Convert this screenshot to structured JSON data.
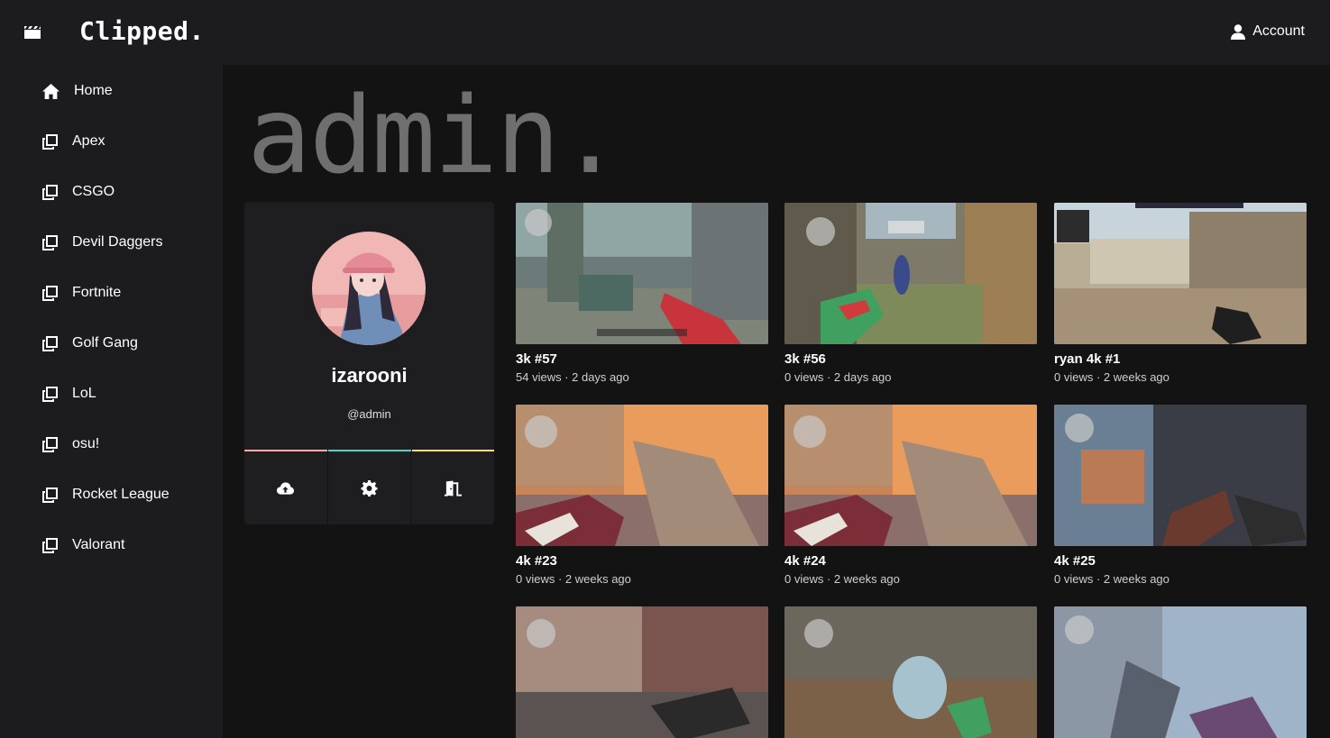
{
  "header": {
    "brand": "Clipped.",
    "logo_icon": "clapperboard-icon",
    "account_label": "Account",
    "account_icon": "user-icon"
  },
  "sidebar": {
    "items": [
      {
        "label": "Home",
        "icon": "home-icon"
      },
      {
        "label": "Apex",
        "icon": "external-link-icon"
      },
      {
        "label": "CSGO",
        "icon": "external-link-icon"
      },
      {
        "label": "Devil Daggers",
        "icon": "external-link-icon"
      },
      {
        "label": "Fortnite",
        "icon": "external-link-icon"
      },
      {
        "label": "Golf Gang",
        "icon": "external-link-icon"
      },
      {
        "label": "LoL",
        "icon": "external-link-icon"
      },
      {
        "label": "osu!",
        "icon": "external-link-icon"
      },
      {
        "label": "Rocket League",
        "icon": "external-link-icon"
      },
      {
        "label": "Valorant",
        "icon": "external-link-icon"
      }
    ]
  },
  "main": {
    "page_title": "admin."
  },
  "profile": {
    "display_name": "izarooni",
    "handle": "@admin",
    "accent_colors": [
      "#f7a8a8",
      "#4fd1c5",
      "#f6e05e"
    ],
    "actions": [
      {
        "icon": "cloud-upload-icon"
      },
      {
        "icon": "gear-icon"
      },
      {
        "icon": "door-exit-icon"
      }
    ]
  },
  "clips": [
    {
      "title": "3k #57",
      "meta": "54 views · 2 days ago"
    },
    {
      "title": "3k #56",
      "meta": "0 views · 2 days ago"
    },
    {
      "title": "ryan 4k #1",
      "meta": "0 views · 2 weeks ago"
    },
    {
      "title": "4k #23",
      "meta": "0 views · 2 weeks ago"
    },
    {
      "title": "4k #24",
      "meta": "0 views · 2 weeks ago"
    },
    {
      "title": "4k #25",
      "meta": "0 views · 2 weeks ago"
    },
    {
      "title": "",
      "meta": ""
    },
    {
      "title": "",
      "meta": ""
    },
    {
      "title": "",
      "meta": ""
    }
  ]
}
